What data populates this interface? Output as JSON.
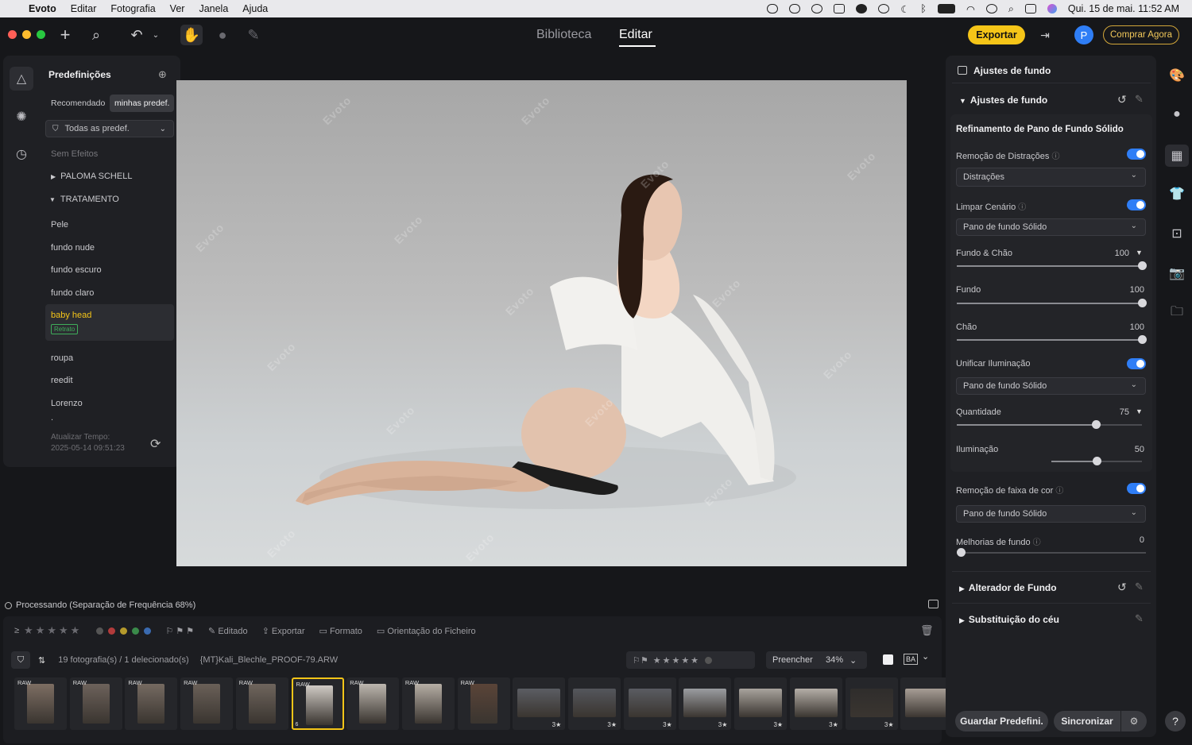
{
  "menubar": {
    "apple": "",
    "app": "Evoto",
    "items": [
      "Editar",
      "Fotografia",
      "Ver",
      "Janela",
      "Ajuda"
    ],
    "clock": "Qui. 15 de mai.  11:52 AM"
  },
  "toolbar": {
    "tabs": [
      {
        "label": "Biblioteca"
      },
      {
        "label": "Editar"
      }
    ],
    "export": "Exportar",
    "avatar": "P",
    "buy": "Comprar Agora"
  },
  "left_panel": {
    "title": "Predefinições",
    "chips": [
      "Recomendado",
      "minhas predef."
    ],
    "filter": "Todas as predef.",
    "no_effects": "Sem Efeitos",
    "groups": [
      {
        "label": "PALOMA SCHELL",
        "expanded": false
      },
      {
        "label": "TRATAMENTO",
        "expanded": true
      }
    ],
    "presets": [
      "Pele",
      "fundo nude",
      "fundo escuro",
      "fundo claro",
      "baby head",
      "roupa",
      "reedit",
      "Lorenzo"
    ],
    "selected_tag": "Retrato",
    "dot": ".",
    "updated_label": "Atualizar Tempo:",
    "updated_time": "2025-05-14 09:51:23"
  },
  "canvas": {
    "watermark": "Evoto"
  },
  "status": {
    "text": "Processando (Separação de Frequência 68%)"
  },
  "bottom": {
    "filters": {
      "edited": "Editado",
      "export": "Exportar",
      "format": "Formato",
      "orientation": "Orientação do Ficheiro"
    },
    "info": "19 fotografia(s) / 1 delecionado(s)",
    "filename": "{MT}Kali_Blechle_PROOF-79.ARW",
    "fill": "Preencher",
    "zoom": "34%",
    "ba": "BA",
    "thumbs": [
      {
        "tag": "RAW",
        "stars": ""
      },
      {
        "tag": "RAW",
        "stars": ""
      },
      {
        "tag": "RAW",
        "stars": ""
      },
      {
        "tag": "RAW",
        "stars": ""
      },
      {
        "tag": "RAW",
        "stars": ""
      },
      {
        "tag": "RAW",
        "stars": "",
        "selected": true,
        "index": "6"
      },
      {
        "tag": "RAW",
        "stars": ""
      },
      {
        "tag": "RAW",
        "stars": ""
      },
      {
        "tag": "RAW",
        "stars": ""
      },
      {
        "tag": "",
        "stars": "3★"
      },
      {
        "tag": "",
        "stars": "3★"
      },
      {
        "tag": "",
        "stars": "3★"
      },
      {
        "tag": "",
        "stars": "3★"
      },
      {
        "tag": "",
        "stars": "3★"
      },
      {
        "tag": "",
        "stars": "3★"
      },
      {
        "tag": "",
        "stars": "3★"
      },
      {
        "tag": "",
        "stars": ""
      }
    ]
  },
  "right_panel": {
    "header": "Ajustes de fundo",
    "section": "Ajustes de fundo",
    "subsection": "Refinamento de Pano de Fundo Sólido",
    "distraction_removal": "Remoção de Distrações",
    "distraction_dd": "Distrações",
    "clean_scene": "Limpar Cenário",
    "clean_dd": "Pano de fundo Sólido",
    "bg_floor": {
      "label": "Fundo & Chão",
      "value": 100
    },
    "bg": {
      "label": "Fundo",
      "value": 100
    },
    "floor": {
      "label": "Chão",
      "value": 100
    },
    "unify": "Unificar Iluminação",
    "unify_dd": "Pano de fundo Sólido",
    "quantity": {
      "label": "Quantidade",
      "value": 75
    },
    "lighting": {
      "label": "Iluminação",
      "value": 50
    },
    "banding": "Remoção de faixa de cor",
    "banding_dd": "Pano de fundo Sólido",
    "improve": {
      "label": "Melhorias de fundo",
      "value": 0
    },
    "changer": "Alterador de Fundo",
    "sky": "Substituição do céu",
    "save": "Guardar Predefini.",
    "sync": "Sincronizar"
  },
  "colors": {
    "accent": "#2f7ef6",
    "export": "#f5c518",
    "selected_preset": "#f5c518",
    "tag": "#3fae5a"
  }
}
